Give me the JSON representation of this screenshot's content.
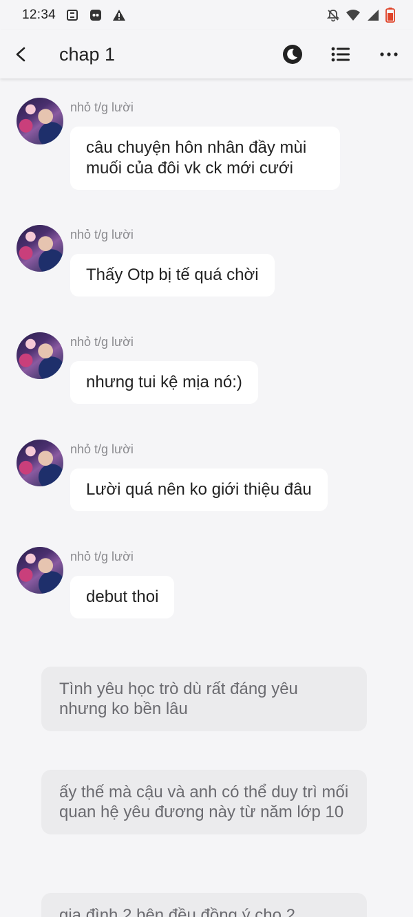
{
  "status_bar": {
    "time": "12:34",
    "left_icons": [
      "screenshot-icon",
      "app-notification-icon",
      "warning-icon"
    ],
    "right_icons": [
      "notifications-off-icon",
      "wifi-icon",
      "signal-icon",
      "battery-icon"
    ]
  },
  "app_bar": {
    "title": "chap 1",
    "icons": [
      "back-icon",
      "night-mode-icon",
      "list-icon",
      "more-icon"
    ]
  },
  "messages": [
    {
      "sender": "nhỏ t/g lười",
      "text": "câu chuyện hôn nhân đầy mùi muối của đôi vk ck mới cưới"
    },
    {
      "sender": "nhỏ t/g lười",
      "text": "Thấy Otp bị tế quá chời"
    },
    {
      "sender": "nhỏ t/g lười",
      "text": "nhưng tui kệ mịa nó:)"
    },
    {
      "sender": "nhỏ t/g lười",
      "text": "Lười quá nên ko giới thiệu đâu"
    },
    {
      "sender": "nhỏ t/g lười",
      "text": "debut thoi"
    }
  ],
  "narrations": [
    {
      "text": "Tình yêu học trò dù rất đáng yêu nhưng ko bền lâu"
    },
    {
      "text": "ấy thế mà cậu và anh có thể duy trì mối quan hệ yêu đương này từ năm lớp 10"
    },
    {
      "text": "gia đình 2 bên đều đồng ý cho 2"
    }
  ],
  "colors": {
    "background": "#f5f5f7",
    "bubble": "#ffffff",
    "narration_bubble": "#ebebed",
    "sender_text": "#8a8a8e",
    "narration_text": "#6b6b70"
  }
}
